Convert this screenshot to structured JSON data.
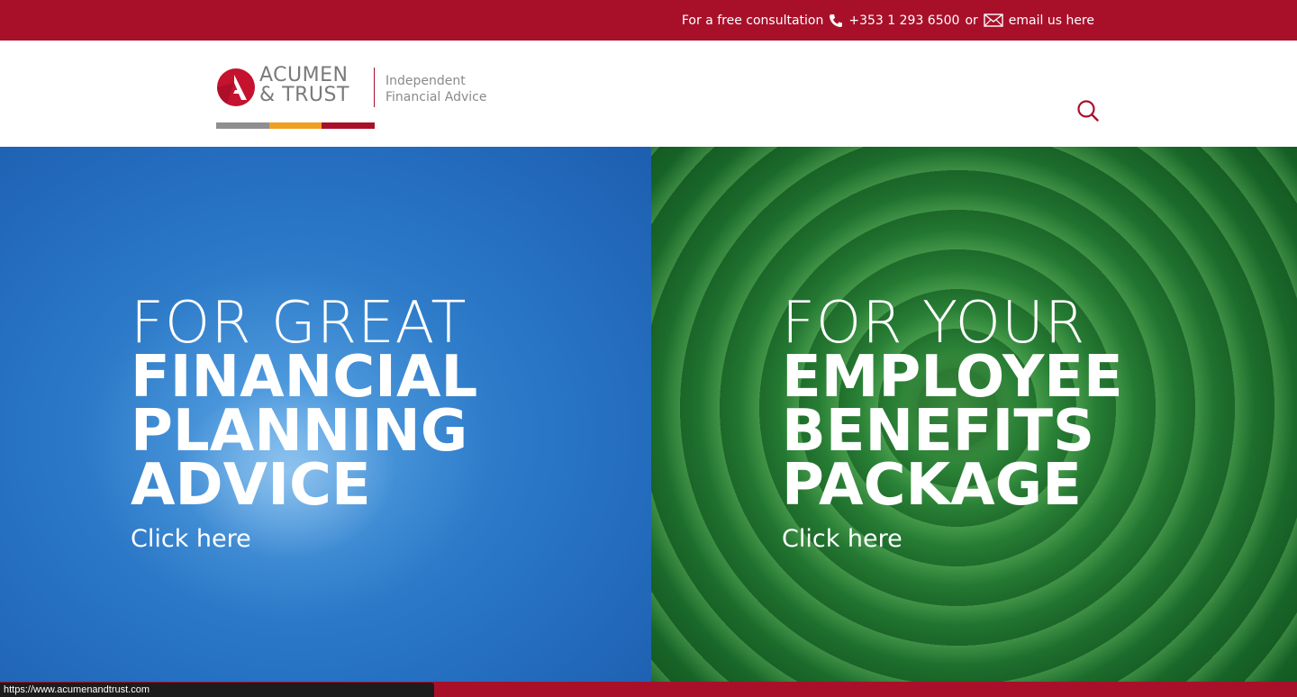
{
  "topbar": {
    "consult_text": "For a free consultation",
    "phone_icon": "phone-icon",
    "phone": "+353 1 293 6500",
    "or_text": "or",
    "mail_icon": "envelope-icon",
    "email_link": "email us here",
    "bg_color": "#a8102a"
  },
  "header": {
    "logo": {
      "name_line1": "ACUMEN",
      "name_line2": "& TRUST",
      "tagline_line1": "Independent",
      "tagline_line2": "Financial Advice",
      "stripe_colors": [
        "#8f8f8f",
        "#f0a020",
        "#a8102a"
      ]
    },
    "search_icon": "search-icon"
  },
  "panels": [
    {
      "light": "FOR GREAT",
      "bold_lines": [
        "FINANCIAL",
        "PLANNING",
        "ADVICE"
      ],
      "cta": "Click here",
      "color": "#2670c2"
    },
    {
      "light": "FOR YOUR",
      "bold_lines": [
        "EMPLOYEE",
        "BENEFITS",
        "PACKAGE"
      ],
      "cta": "Click here",
      "color": "#1d6e2d"
    }
  ],
  "status_bar": {
    "url": "https://www.acumenandtrust.com"
  }
}
